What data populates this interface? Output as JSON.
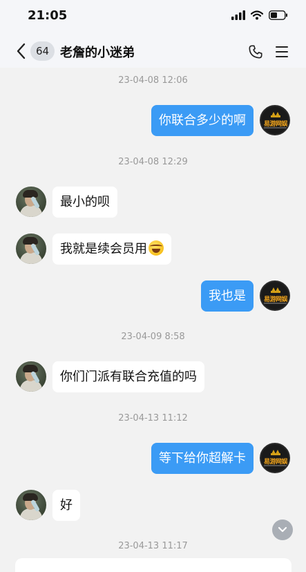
{
  "status_bar": {
    "time": "21:05",
    "icons": [
      "signal-icon",
      "wifi-icon",
      "battery-icon"
    ]
  },
  "nav": {
    "unread_count": "64",
    "title": "老詹的小迷弟",
    "icons": [
      "back-icon",
      "phone-icon",
      "menu-icon"
    ]
  },
  "messages": {
    "ts1": "23-04-08 12:06",
    "m1": "你联合多少的啊",
    "ts2": "23-04-08 12:29",
    "m2": "最小的呗",
    "m3": "我就是续会员用",
    "m3_emoji": "face-with-tears-of-joy",
    "m4": "我也是",
    "ts3": "23-04-09 8:58",
    "m5": "你们门派有联合充值的吗",
    "ts4": "23-04-13 11:12",
    "m6": "等下给你超解卡",
    "m7": "好",
    "ts5": "23-04-13 11:17"
  },
  "logo_avatar_text": "易游网娱",
  "colors": {
    "outgoing_bubble": "#3b9bf5",
    "incoming_bubble": "#ffffff",
    "background": "#f2f2f2"
  }
}
